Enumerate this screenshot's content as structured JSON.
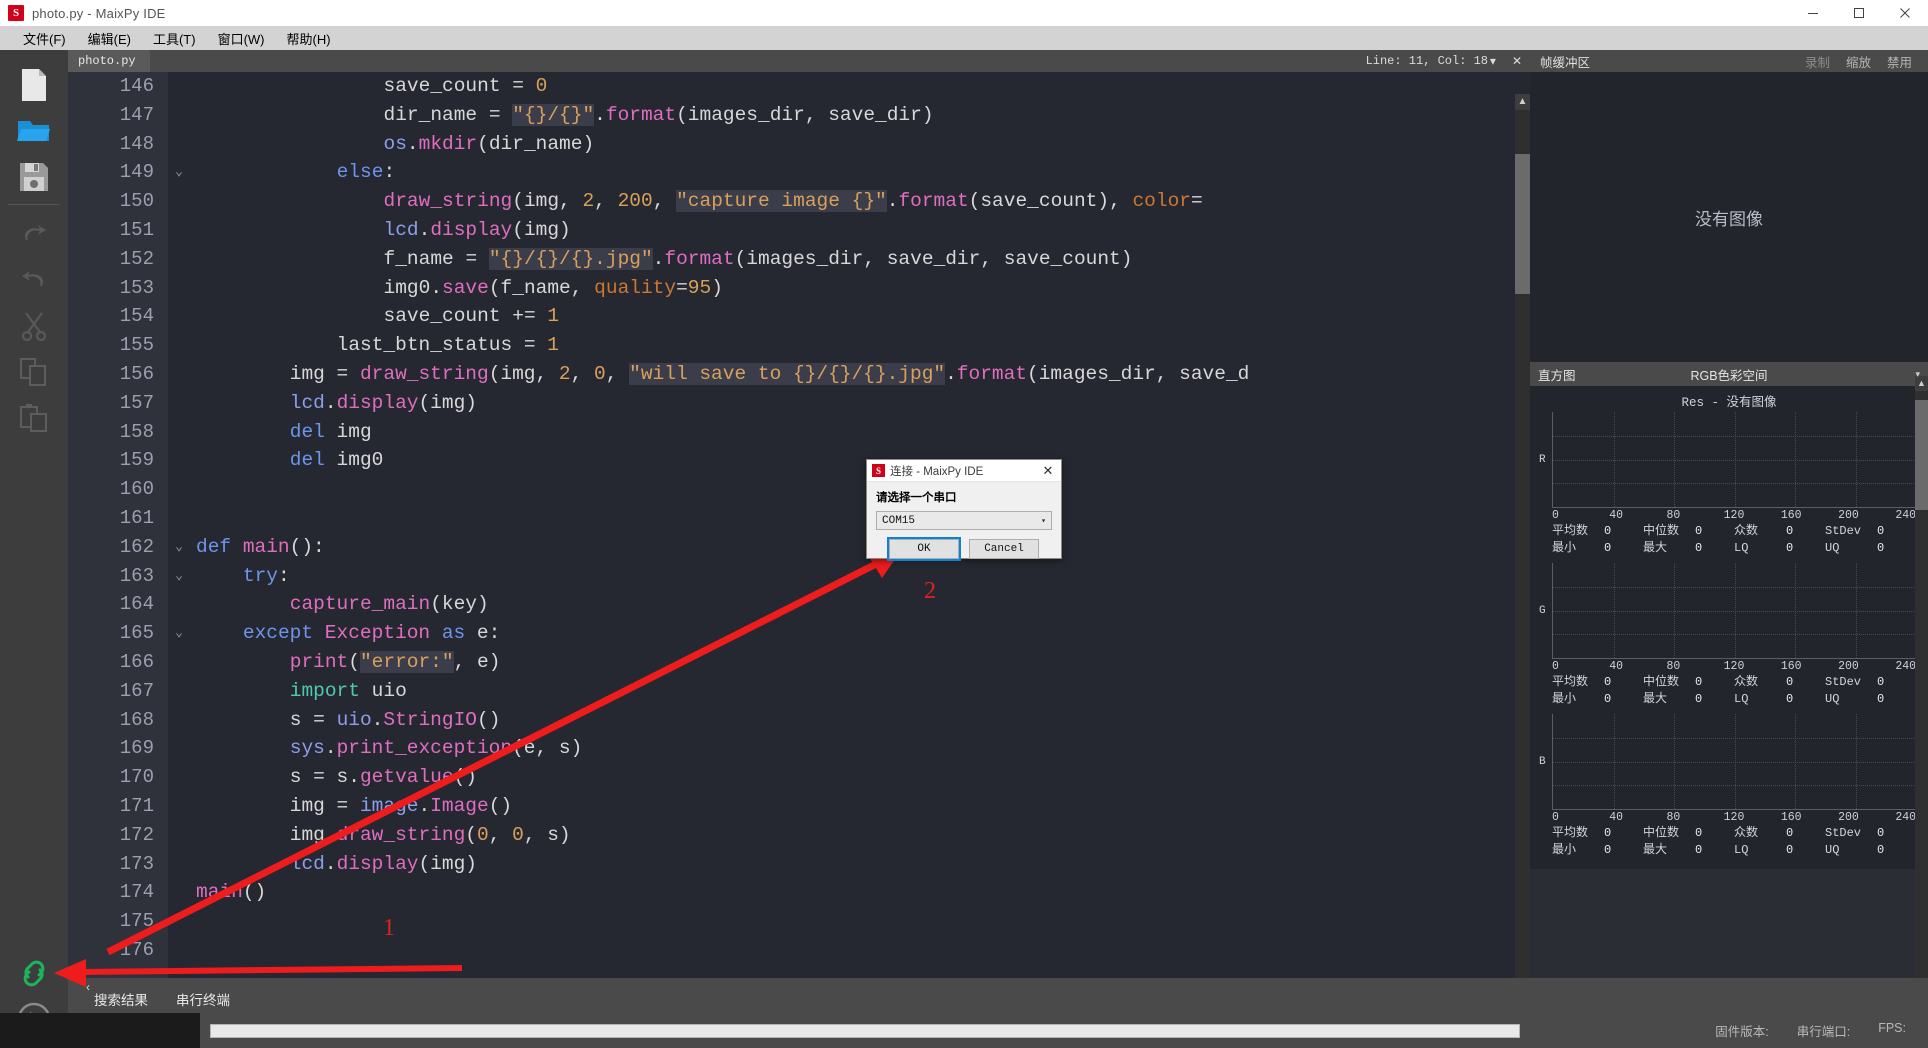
{
  "window": {
    "title": "photo.py - MaixPy IDE",
    "logo_letter": "S",
    "buttons": {
      "minimize": "minimize-icon",
      "maximize": "maximize-icon",
      "close": "close-icon"
    }
  },
  "menubar": {
    "items": [
      {
        "label": "文件(F)"
      },
      {
        "label": "编辑(E)"
      },
      {
        "label": "工具(T)"
      },
      {
        "label": "窗口(W)"
      },
      {
        "label": "帮助(H)"
      }
    ]
  },
  "left_toolbar": {
    "items": [
      {
        "name": "new-file-icon"
      },
      {
        "name": "open-folder-icon"
      },
      {
        "name": "save-icon"
      },
      {
        "name": "undo-icon"
      },
      {
        "name": "redo-icon"
      },
      {
        "name": "cut-icon"
      },
      {
        "name": "copy-icon"
      },
      {
        "name": "paste-icon"
      }
    ],
    "bottom": [
      {
        "name": "connect-link-icon"
      },
      {
        "name": "run-play-icon"
      }
    ]
  },
  "editor": {
    "tab_label": "photo.py",
    "tab_caret": "▾",
    "tab_close": "✕",
    "line_info": "Line: 11, Col: 18",
    "first_line_number": 146,
    "lines": [
      {
        "n": "146",
        "fold": "",
        "indent": 16,
        "tokens": [
          {
            "t": "save_count ",
            "c": "c-plain"
          },
          {
            "t": "= ",
            "c": "c-plain"
          },
          {
            "t": "0",
            "c": "c-num"
          }
        ]
      },
      {
        "n": "147",
        "fold": "",
        "indent": 16,
        "tokens": [
          {
            "t": "dir_name ",
            "c": "c-plain"
          },
          {
            "t": "= ",
            "c": "c-plain"
          },
          {
            "t": "\"{}/{}\"",
            "c": "c-str"
          },
          {
            "t": ".",
            "c": "c-plain"
          },
          {
            "t": "format",
            "c": "c-fn"
          },
          {
            "t": "(images_dir, save_dir)",
            "c": "c-plain"
          }
        ]
      },
      {
        "n": "148",
        "fold": "",
        "indent": 16,
        "tokens": [
          {
            "t": "os",
            "c": "c-mod"
          },
          {
            "t": ".",
            "c": "c-plain"
          },
          {
            "t": "mkdir",
            "c": "c-fn"
          },
          {
            "t": "(dir_name)",
            "c": "c-plain"
          }
        ]
      },
      {
        "n": "149",
        "fold": "⌄",
        "indent": 12,
        "tokens": [
          {
            "t": "else",
            "c": "c-kw"
          },
          {
            "t": ":",
            "c": "c-plain"
          }
        ]
      },
      {
        "n": "150",
        "fold": "",
        "indent": 16,
        "tokens": [
          {
            "t": "draw_string",
            "c": "c-fn"
          },
          {
            "t": "(img, ",
            "c": "c-plain"
          },
          {
            "t": "2",
            "c": "c-num"
          },
          {
            "t": ", ",
            "c": "c-plain"
          },
          {
            "t": "200",
            "c": "c-num"
          },
          {
            "t": ", ",
            "c": "c-plain"
          },
          {
            "t": "\"capture image {}\"",
            "c": "c-str"
          },
          {
            "t": ".",
            "c": "c-plain"
          },
          {
            "t": "format",
            "c": "c-fn"
          },
          {
            "t": "(save_count), ",
            "c": "c-plain"
          },
          {
            "t": "color",
            "c": "c-kwarg"
          },
          {
            "t": "=",
            "c": "c-plain"
          }
        ]
      },
      {
        "n": "151",
        "fold": "",
        "indent": 16,
        "tokens": [
          {
            "t": "lcd",
            "c": "c-mod"
          },
          {
            "t": ".",
            "c": "c-plain"
          },
          {
            "t": "display",
            "c": "c-fn"
          },
          {
            "t": "(img)",
            "c": "c-plain"
          }
        ]
      },
      {
        "n": "152",
        "fold": "",
        "indent": 16,
        "tokens": [
          {
            "t": "f_name ",
            "c": "c-plain"
          },
          {
            "t": "= ",
            "c": "c-plain"
          },
          {
            "t": "\"{}/{}/{}.jpg\"",
            "c": "c-str"
          },
          {
            "t": ".",
            "c": "c-plain"
          },
          {
            "t": "format",
            "c": "c-fn"
          },
          {
            "t": "(images_dir, save_dir, save_count)",
            "c": "c-plain"
          }
        ]
      },
      {
        "n": "153",
        "fold": "",
        "indent": 16,
        "tokens": [
          {
            "t": "img0",
            "c": "c-plain"
          },
          {
            "t": ".",
            "c": "c-plain"
          },
          {
            "t": "save",
            "c": "c-fn"
          },
          {
            "t": "(f_name, ",
            "c": "c-plain"
          },
          {
            "t": "quality",
            "c": "c-kwarg"
          },
          {
            "t": "=",
            "c": "c-plain"
          },
          {
            "t": "95",
            "c": "c-num"
          },
          {
            "t": ")",
            "c": "c-plain"
          }
        ]
      },
      {
        "n": "154",
        "fold": "",
        "indent": 16,
        "tokens": [
          {
            "t": "save_count += ",
            "c": "c-plain"
          },
          {
            "t": "1",
            "c": "c-num"
          }
        ]
      },
      {
        "n": "155",
        "fold": "",
        "indent": 12,
        "tokens": [
          {
            "t": "last_btn_status = ",
            "c": "c-plain"
          },
          {
            "t": "1",
            "c": "c-num"
          }
        ]
      },
      {
        "n": "156",
        "fold": "",
        "indent": 8,
        "tokens": [
          {
            "t": "img = ",
            "c": "c-plain"
          },
          {
            "t": "draw_string",
            "c": "c-fn"
          },
          {
            "t": "(img, ",
            "c": "c-plain"
          },
          {
            "t": "2",
            "c": "c-num"
          },
          {
            "t": ", ",
            "c": "c-plain"
          },
          {
            "t": "0",
            "c": "c-num"
          },
          {
            "t": ", ",
            "c": "c-plain"
          },
          {
            "t": "\"will save to {}/{}/{}.jpg\"",
            "c": "c-str"
          },
          {
            "t": ".",
            "c": "c-plain"
          },
          {
            "t": "format",
            "c": "c-fn"
          },
          {
            "t": "(images_dir, save_d",
            "c": "c-plain"
          }
        ]
      },
      {
        "n": "157",
        "fold": "",
        "indent": 8,
        "tokens": [
          {
            "t": "lcd",
            "c": "c-mod"
          },
          {
            "t": ".",
            "c": "c-plain"
          },
          {
            "t": "display",
            "c": "c-fn"
          },
          {
            "t": "(img)",
            "c": "c-plain"
          }
        ]
      },
      {
        "n": "158",
        "fold": "",
        "indent": 8,
        "tokens": [
          {
            "t": "del",
            "c": "c-kw"
          },
          {
            "t": " img",
            "c": "c-plain"
          }
        ]
      },
      {
        "n": "159",
        "fold": "",
        "indent": 8,
        "tokens": [
          {
            "t": "del",
            "c": "c-kw"
          },
          {
            "t": " img0",
            "c": "c-plain"
          }
        ]
      },
      {
        "n": "160",
        "fold": "",
        "indent": 0,
        "tokens": []
      },
      {
        "n": "161",
        "fold": "",
        "indent": 0,
        "tokens": []
      },
      {
        "n": "162",
        "fold": "⌄",
        "indent": 0,
        "tokens": [
          {
            "t": "def",
            "c": "c-kw"
          },
          {
            "t": " ",
            "c": "c-plain"
          },
          {
            "t": "main",
            "c": "c-fn"
          },
          {
            "t": "():",
            "c": "c-plain"
          }
        ]
      },
      {
        "n": "163",
        "fold": "⌄",
        "indent": 4,
        "tokens": [
          {
            "t": "try",
            "c": "c-kw"
          },
          {
            "t": ":",
            "c": "c-plain"
          }
        ]
      },
      {
        "n": "164",
        "fold": "",
        "indent": 8,
        "tokens": [
          {
            "t": "capture_main",
            "c": "c-fn"
          },
          {
            "t": "(key)",
            "c": "c-plain"
          }
        ]
      },
      {
        "n": "165",
        "fold": "⌄",
        "indent": 4,
        "tokens": [
          {
            "t": "except",
            "c": "c-kw"
          },
          {
            "t": " ",
            "c": "c-plain"
          },
          {
            "t": "Exception",
            "c": "c-fn"
          },
          {
            "t": " ",
            "c": "c-plain"
          },
          {
            "t": "as",
            "c": "c-kw"
          },
          {
            "t": " e:",
            "c": "c-plain"
          }
        ]
      },
      {
        "n": "166",
        "fold": "",
        "indent": 8,
        "tokens": [
          {
            "t": "print",
            "c": "c-fn"
          },
          {
            "t": "(",
            "c": "c-plain"
          },
          {
            "t": "\"error:\"",
            "c": "c-str"
          },
          {
            "t": ", e)",
            "c": "c-plain"
          }
        ]
      },
      {
        "n": "167",
        "fold": "",
        "indent": 8,
        "tokens": [
          {
            "t": "import",
            "c": "c-imp"
          },
          {
            "t": " uio",
            "c": "c-plain"
          }
        ]
      },
      {
        "n": "168",
        "fold": "",
        "indent": 8,
        "tokens": [
          {
            "t": "s = ",
            "c": "c-plain"
          },
          {
            "t": "uio",
            "c": "c-mod"
          },
          {
            "t": ".",
            "c": "c-plain"
          },
          {
            "t": "StringIO",
            "c": "c-fn"
          },
          {
            "t": "()",
            "c": "c-plain"
          }
        ]
      },
      {
        "n": "169",
        "fold": "",
        "indent": 8,
        "tokens": [
          {
            "t": "sys",
            "c": "c-mod"
          },
          {
            "t": ".",
            "c": "c-plain"
          },
          {
            "t": "print_exception",
            "c": "c-fn"
          },
          {
            "t": "(e, s)",
            "c": "c-plain"
          }
        ]
      },
      {
        "n": "170",
        "fold": "",
        "indent": 8,
        "tokens": [
          {
            "t": "s = s",
            "c": "c-plain"
          },
          {
            "t": ".",
            "c": "c-plain"
          },
          {
            "t": "getvalue",
            "c": "c-fn"
          },
          {
            "t": "()",
            "c": "c-plain"
          }
        ]
      },
      {
        "n": "171",
        "fold": "",
        "indent": 8,
        "tokens": [
          {
            "t": "img = ",
            "c": "c-plain"
          },
          {
            "t": "image",
            "c": "c-mod"
          },
          {
            "t": ".",
            "c": "c-plain"
          },
          {
            "t": "Image",
            "c": "c-fn"
          },
          {
            "t": "()",
            "c": "c-plain"
          }
        ]
      },
      {
        "n": "172",
        "fold": "",
        "indent": 8,
        "tokens": [
          {
            "t": "img",
            "c": "c-plain"
          },
          {
            "t": ".",
            "c": "c-plain"
          },
          {
            "t": "draw_string",
            "c": "c-fn"
          },
          {
            "t": "(",
            "c": "c-plain"
          },
          {
            "t": "0",
            "c": "c-num"
          },
          {
            "t": ", ",
            "c": "c-plain"
          },
          {
            "t": "0",
            "c": "c-num"
          },
          {
            "t": ", s)",
            "c": "c-plain"
          }
        ]
      },
      {
        "n": "173",
        "fold": "",
        "indent": 8,
        "tokens": [
          {
            "t": "lcd",
            "c": "c-mod"
          },
          {
            "t": ".",
            "c": "c-plain"
          },
          {
            "t": "display",
            "c": "c-fn"
          },
          {
            "t": "(img)",
            "c": "c-plain"
          }
        ]
      },
      {
        "n": "174",
        "fold": "",
        "indent": 0,
        "tokens": [
          {
            "t": "main",
            "c": "c-fn"
          },
          {
            "t": "()",
            "c": "c-plain"
          }
        ]
      },
      {
        "n": "175",
        "fold": "",
        "indent": 0,
        "tokens": []
      },
      {
        "n": "176",
        "fold": "",
        "indent": 0,
        "tokens": []
      }
    ]
  },
  "framebuffer_panel": {
    "title": "帧缓冲区",
    "actions": [
      {
        "label": "录制",
        "enabled": false
      },
      {
        "label": "缩放",
        "enabled": true
      },
      {
        "label": "禁用",
        "enabled": true
      }
    ],
    "empty_text": "没有图像"
  },
  "histogram_panel": {
    "title": "直方图",
    "colorspace": "RGB色彩空间",
    "caret": "▾",
    "res_text": "Res - 没有图像",
    "axis_ticks": [
      "0",
      "40",
      "80",
      "120",
      "160",
      "200",
      "240"
    ],
    "channels": [
      {
        "label": "R",
        "stats": [
          {
            "key": "平均数",
            "value": "0"
          },
          {
            "key": "中位数",
            "value": "0"
          },
          {
            "key": "众数",
            "value": "0"
          },
          {
            "key": "StDev",
            "value": "0"
          },
          {
            "key": "最小",
            "value": "0"
          },
          {
            "key": "最大",
            "value": "0"
          },
          {
            "key": "LQ",
            "value": "0"
          },
          {
            "key": "UQ",
            "value": "0"
          }
        ]
      },
      {
        "label": "G",
        "stats": [
          {
            "key": "平均数",
            "value": "0"
          },
          {
            "key": "中位数",
            "value": "0"
          },
          {
            "key": "众数",
            "value": "0"
          },
          {
            "key": "StDev",
            "value": "0"
          },
          {
            "key": "最小",
            "value": "0"
          },
          {
            "key": "最大",
            "value": "0"
          },
          {
            "key": "LQ",
            "value": "0"
          },
          {
            "key": "UQ",
            "value": "0"
          }
        ]
      },
      {
        "label": "B",
        "stats": [
          {
            "key": "平均数",
            "value": "0"
          },
          {
            "key": "中位数",
            "value": "0"
          },
          {
            "key": "众数",
            "value": "0"
          },
          {
            "key": "StDev",
            "value": "0"
          },
          {
            "key": "最小",
            "value": "0"
          },
          {
            "key": "最大",
            "value": "0"
          },
          {
            "key": "LQ",
            "value": "0"
          },
          {
            "key": "UQ",
            "value": "0"
          }
        ]
      }
    ]
  },
  "bottom_tabs": {
    "collapse_icon": "‹",
    "items": [
      {
        "label": "搜索结果"
      },
      {
        "label": "串行终端"
      }
    ]
  },
  "statusbar": {
    "progress_percent": 0,
    "items": [
      {
        "label": "固件版本:"
      },
      {
        "label": "串行端口:"
      },
      {
        "label": "FPS:"
      }
    ]
  },
  "dialog": {
    "logo_letter": "S",
    "title": "连接 - MaixPy IDE",
    "close": "✕",
    "prompt": "请选择一个串口",
    "port_value": "COM15",
    "caret": "▾",
    "ok_label": "OK",
    "cancel_label": "Cancel"
  },
  "annotations": {
    "marker_1": "1",
    "marker_2": "2",
    "color": "#ee1c1c"
  }
}
